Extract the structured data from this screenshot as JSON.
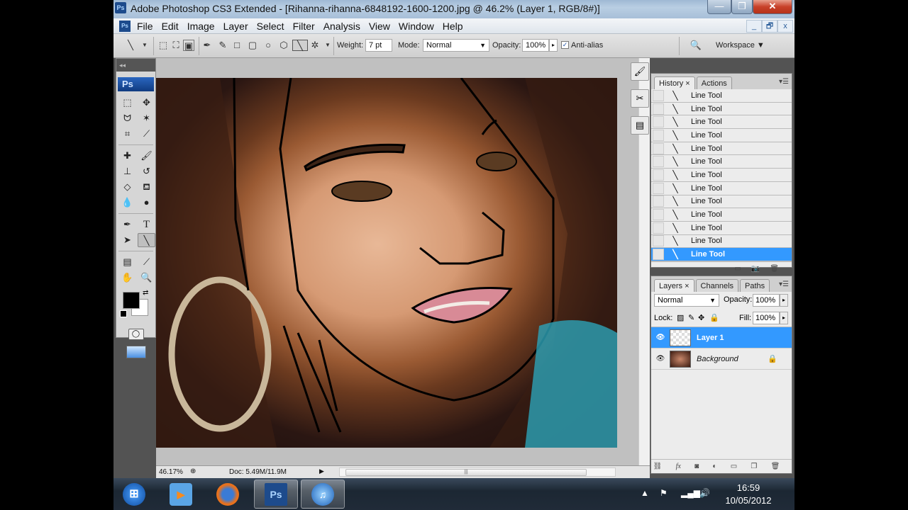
{
  "window": {
    "title": "Adobe Photoshop CS3 Extended - [Rihanna-rihanna-6848192-1600-1200.jpg @ 46.2% (Layer 1, RGB/8#)]",
    "app_icon": "Ps",
    "controls": {
      "minimize": "—",
      "maximize": "❐",
      "close": "✕"
    }
  },
  "menu": {
    "icon": "Ps",
    "items": [
      "File",
      "Edit",
      "Image",
      "Layer",
      "Select",
      "Filter",
      "Analysis",
      "View",
      "Window",
      "Help"
    ],
    "doc_controls": {
      "minimize": "_",
      "restore": "🗗",
      "close": "x"
    }
  },
  "options": {
    "weight_label": "Weight:",
    "weight_value": "7 pt",
    "mode_label": "Mode:",
    "mode_value": "Normal",
    "opacity_label": "Opacity:",
    "opacity_value": "100%",
    "antialias_label": "Anti-alias",
    "antialias_checked": true,
    "workspace_label": "Workspace ▼"
  },
  "toolbox": {
    "header": "◂◂",
    "logo": "Ps",
    "active_tool": "line-tool",
    "foreground_color": "#000000",
    "background_color": "#ffffff"
  },
  "status": {
    "zoom": "46.17%",
    "doc": "Doc: 5.49M/11.9M"
  },
  "history": {
    "tabs": [
      "History",
      "Actions"
    ],
    "active_tab": "History",
    "items": [
      "Line Tool",
      "Line Tool",
      "Line Tool",
      "Line Tool",
      "Line Tool",
      "Line Tool",
      "Line Tool",
      "Line Tool",
      "Line Tool",
      "Line Tool",
      "Line Tool",
      "Line Tool",
      "Line Tool"
    ],
    "selected_index": 12
  },
  "layers": {
    "tabs": [
      "Layers",
      "Channels",
      "Paths"
    ],
    "active_tab": "Layers",
    "blend_mode": "Normal",
    "opacity_label": "Opacity:",
    "opacity_value": "100%",
    "lock_label": "Lock:",
    "fill_label": "Fill:",
    "fill_value": "100%",
    "items": [
      {
        "name": "Layer 1",
        "selected": true,
        "locked": false
      },
      {
        "name": "Background",
        "selected": false,
        "locked": true
      }
    ]
  },
  "taskbar": {
    "apps": [
      "Start",
      "Windows Media Player",
      "Firefox",
      "Photoshop",
      "iTunes"
    ],
    "ps_label": "Ps",
    "time": "16:59",
    "date": "10/05/2012"
  },
  "colors": {
    "selection": "#3399ff",
    "ps_blue": "#1d4b8c"
  }
}
